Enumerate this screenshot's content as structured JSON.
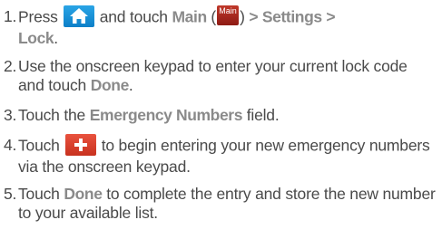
{
  "steps": [
    {
      "number": "1.",
      "text_press": "Press",
      "home_icon": "home-icon",
      "text_and_touch": "and touch",
      "main_label": "Main",
      "paren_open": "(",
      "main_icon_label": "Main",
      "paren_close": ")",
      "sep1": ">",
      "settings_label": "Settings",
      "sep2": ">",
      "lock_label": "Lock",
      "end": "."
    },
    {
      "number": "2.",
      "text_before": "Use the onscreen keypad to enter your current lock code and touch",
      "done_label": "Done",
      "end": "."
    },
    {
      "number": "3.",
      "text_before": "Touch the",
      "field_label": "Emergency Numbers",
      "text_after": "field."
    },
    {
      "number": "4.",
      "text_before": "Touch",
      "plus_icon": "plus-icon",
      "text_after": "to begin entering your new emergency numbers via the onscreen keypad."
    },
    {
      "number": "5.",
      "text_before": "Touch",
      "done_label": "Done",
      "text_after": "to complete the entry and store the new number to your available list."
    }
  ],
  "colors": {
    "text": "#4a4a4a",
    "ui_label": "#8a8a8a",
    "home_icon_bg": "#1a92d8",
    "main_icon_bg": "#a8281c",
    "plus_icon_bg": "#dd4430"
  }
}
